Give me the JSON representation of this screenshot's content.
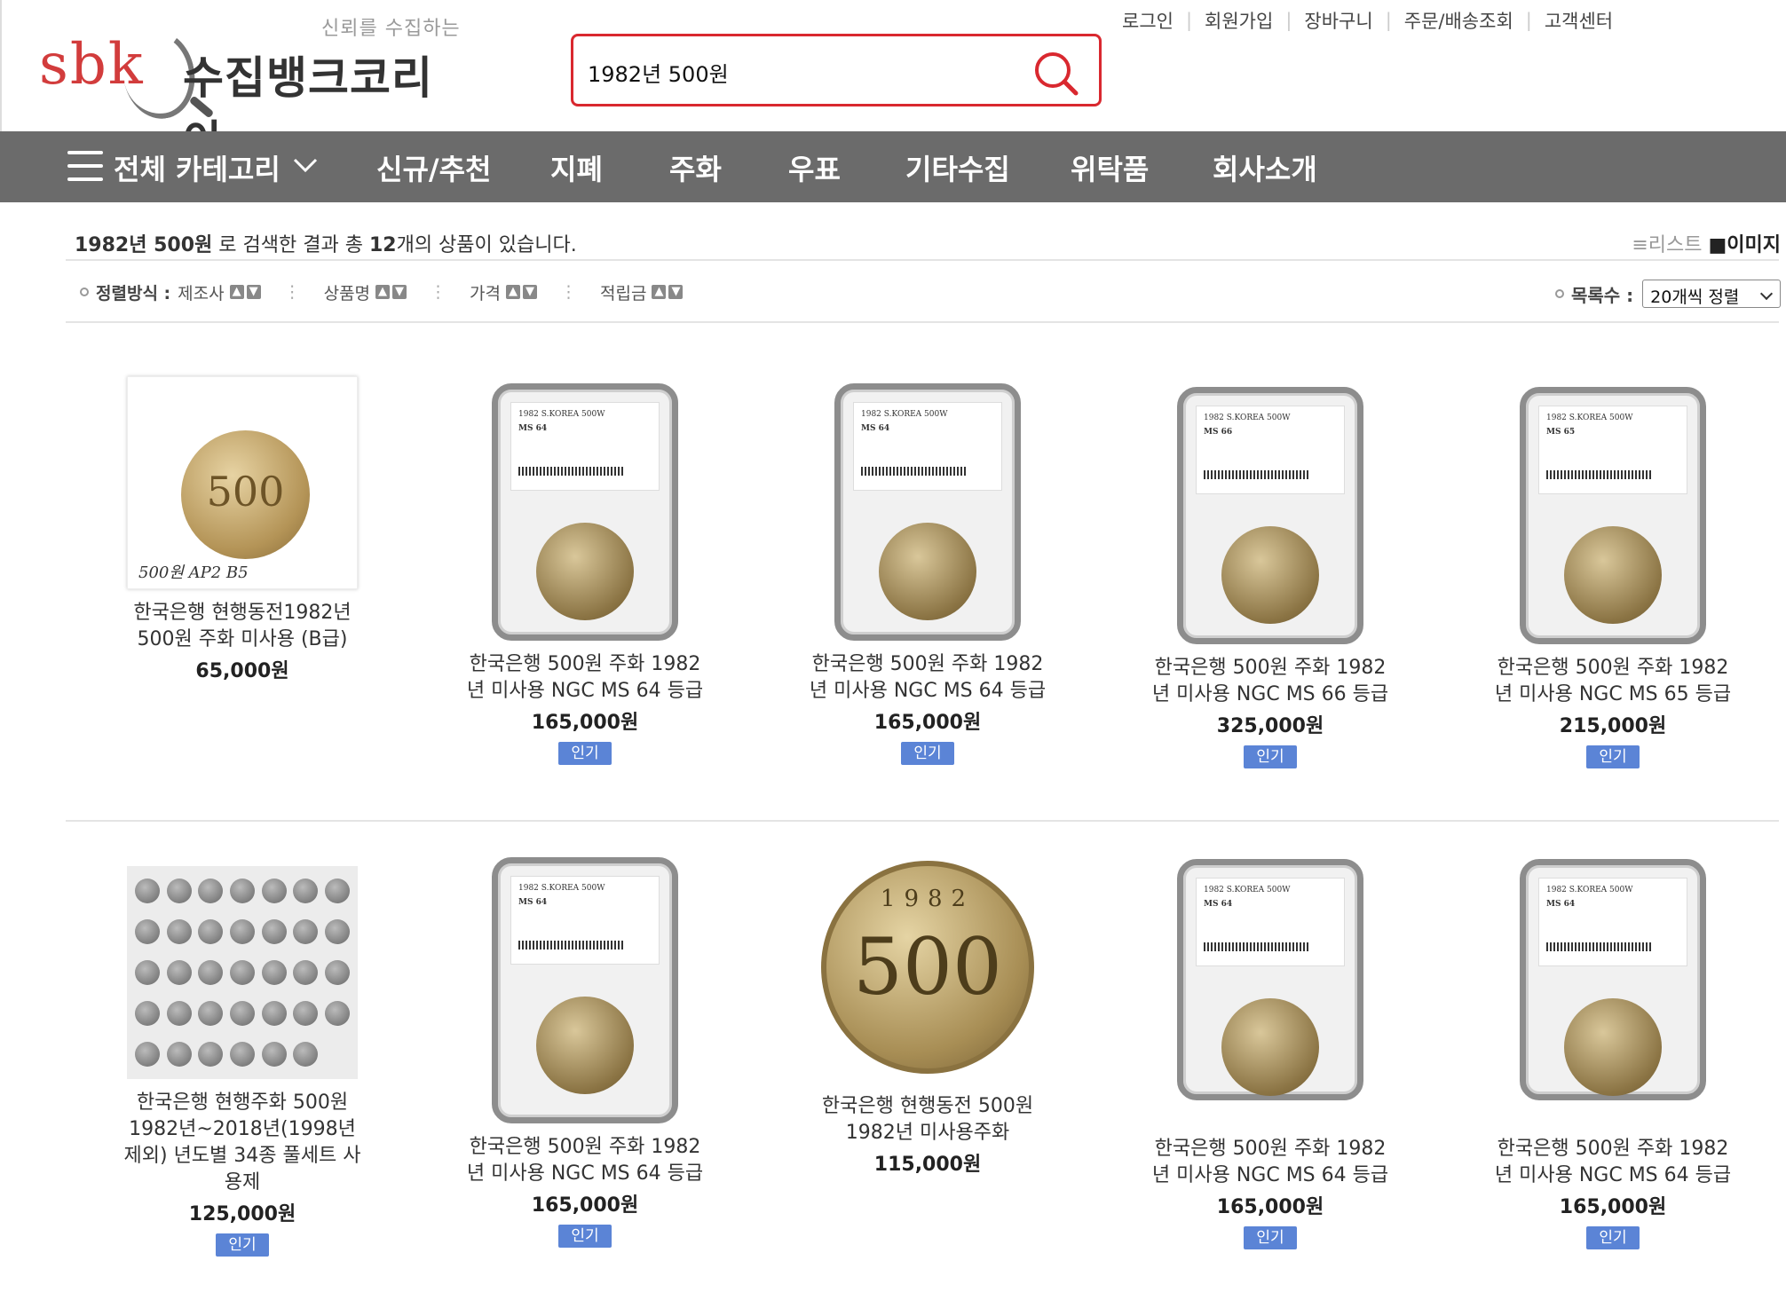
{
  "header": {
    "logo_tagline": "신뢰를 수집하는",
    "logo_mark": "sbk",
    "logo_name": "수집뱅크코리아",
    "search_value": "1982년 500원",
    "top_links": [
      "로그인",
      "회원가입",
      "장바구니",
      "주문/배송조회",
      "고객센터"
    ]
  },
  "nav": {
    "all_categories": "전체 카테고리",
    "items": [
      "신규/추천",
      "지폐",
      "주화",
      "우표",
      "기타수집",
      "위탁품",
      "회사소개"
    ]
  },
  "results": {
    "keyword": "1982년 500원",
    "text_before_count": " 로 검색한 결과 총 ",
    "count": "12",
    "text_after_count": "개의 상품이 있습니다.",
    "view_list": "≡리스트",
    "view_image": "■이미지"
  },
  "sort": {
    "label": "정렬방식 :",
    "options": [
      "제조사",
      "상품명",
      "가격",
      "적립금"
    ],
    "per_page_label": "목록수 :",
    "per_page_value": "20개씩 정렬"
  },
  "products": [
    {
      "name": "한국은행 현행동전1982년 500원 주화 미사용 (B급)",
      "price": "65,000원",
      "badge": "",
      "photo_note": "500원 AP2 B5"
    },
    {
      "name": "한국은행 500원 주화 1982년 미사용 NGC MS 64 등급",
      "price": "165,000원",
      "badge": "인기",
      "slab_line1": "1982 S.KOREA 500W",
      "slab_grade": "MS 64"
    },
    {
      "name": "한국은행 500원 주화 1982년 미사용 NGC MS 64 등급",
      "price": "165,000원",
      "badge": "인기",
      "slab_line1": "1982 S.KOREA 500W",
      "slab_grade": "MS 64"
    },
    {
      "name": "한국은행 500원 주화 1982년 미사용 NGC MS 66 등급",
      "price": "325,000원",
      "badge": "인기",
      "slab_line1": "1982 S.KOREA 500W",
      "slab_grade": "MS 66"
    },
    {
      "name": "한국은행 500원 주화 1982년 미사용 NGC MS 65 등급",
      "price": "215,000원",
      "badge": "인기",
      "slab_line1": "1982 S.KOREA 500W",
      "slab_grade": "MS 65"
    },
    {
      "name": "한국은행 현행주화 500원 1982년~2018년(1998년 제외) 년도별 34종 풀세트 사용제",
      "price": "125,000원",
      "badge": "인기"
    },
    {
      "name": "한국은행 500원 주화 1982년 미사용 NGC MS 64 등급",
      "price": "165,000원",
      "badge": "인기",
      "slab_line1": "1982 S.KOREA 500W",
      "slab_grade": "MS 64"
    },
    {
      "name": "한국은행 현행동전 500원 1982년 미사용주화",
      "price": "115,000원",
      "badge": "",
      "coin_year": "1982",
      "coin_value": "500"
    },
    {
      "name": "한국은행 500원 주화 1982년 미사용 NGC MS 64 등급",
      "price": "165,000원",
      "badge": "인기",
      "slab_line1": "1982 S.KOREA 500W",
      "slab_grade": "MS 64"
    },
    {
      "name": "한국은행 500원 주화 1982년 미사용 NGC MS 64 등급",
      "price": "165,000원",
      "badge": "인기",
      "slab_line1": "1982 S.KOREA 500W",
      "slab_grade": "MS 64"
    }
  ],
  "colors": {
    "accent": "#d9282f",
    "nav_bg": "#6b6b6b",
    "badge": "#5b84d6"
  }
}
